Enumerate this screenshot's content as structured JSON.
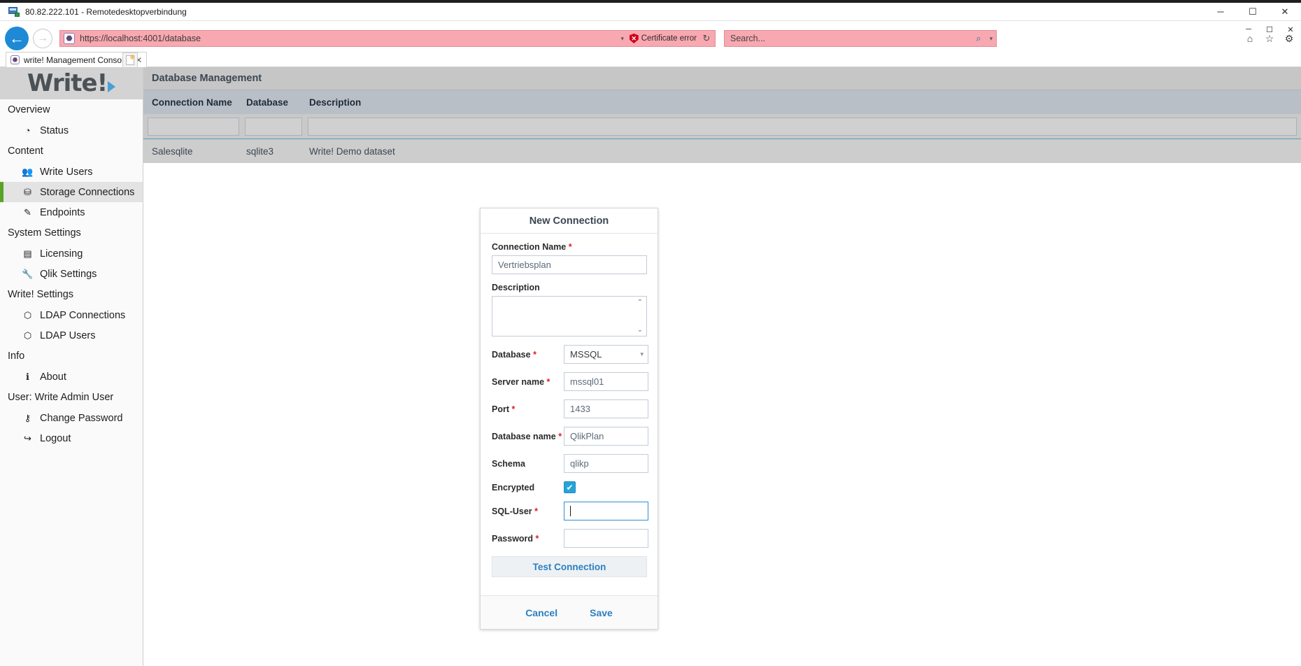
{
  "rdp": {
    "title": "80.82.222.101 - Remotedesktopverbindung",
    "icon": "remote-desktop-icon",
    "minimize": "─",
    "maximize": "☐",
    "close": "✕"
  },
  "browser": {
    "back_icon": "←",
    "forward_icon": "→",
    "favicon_glyph": "⬣",
    "url": "https://localhost:4001/database",
    "address_dropdown_icon": "▾",
    "certificate_error": "Certificate error",
    "certificate_icon": "certificate-error-shield-icon",
    "certificate_badge": "✕",
    "refresh_icon": "↻",
    "search_placeholder": "Search...",
    "search_icon": "⌕",
    "search_caret": "▾",
    "home_icon": "⌂",
    "favorites_icon": "☆",
    "tools_icon": "⚙",
    "window": {
      "minimize": "─",
      "maximize": "☐",
      "close": "✕"
    },
    "tab": {
      "label": "write! Management Console",
      "close": "✕",
      "new_tab_title": "new-tab"
    }
  },
  "logo": {
    "text": "Write",
    "mark": "!"
  },
  "sidebar": {
    "groups": [
      {
        "title": "Overview",
        "items": [
          {
            "label": "Status",
            "icon": "dashboard-icon",
            "glyph": "◔",
            "active": false
          }
        ]
      },
      {
        "title": "Content",
        "items": [
          {
            "label": "Write Users",
            "icon": "users-icon",
            "glyph": "👥",
            "active": false
          },
          {
            "label": "Storage Connections",
            "icon": "database-icon",
            "glyph": "⛁",
            "active": true
          },
          {
            "label": "Endpoints",
            "icon": "pencil-icon",
            "glyph": "✎",
            "active": false
          }
        ]
      },
      {
        "title": "System Settings",
        "items": [
          {
            "label": "Licensing",
            "icon": "id-card-icon",
            "glyph": "▤",
            "active": false
          },
          {
            "label": "Qlik Settings",
            "icon": "wrench-icon",
            "glyph": "🔧",
            "active": false
          }
        ]
      },
      {
        "title": "Write! Settings",
        "items": [
          {
            "label": "LDAP Connections",
            "icon": "ldap-connections-icon",
            "glyph": "⬡",
            "active": false
          },
          {
            "label": "LDAP Users",
            "icon": "ldap-users-icon",
            "glyph": "⬡",
            "active": false
          }
        ]
      },
      {
        "title": "Info",
        "items": [
          {
            "label": "About",
            "icon": "info-icon",
            "glyph": "ℹ",
            "active": false
          }
        ]
      },
      {
        "title": "User: Write Admin User",
        "items": [
          {
            "label": "Change Password",
            "icon": "key-icon",
            "glyph": "⚷",
            "active": false
          },
          {
            "label": "Logout",
            "icon": "logout-icon",
            "glyph": "↪",
            "active": false
          }
        ]
      }
    ]
  },
  "main": {
    "page_title": "Database Management",
    "table": {
      "columns": [
        "Connection Name",
        "Database",
        "Description"
      ],
      "filters": [
        "",
        "",
        ""
      ],
      "rows": [
        {
          "connection_name": "Salesqlite",
          "database": "sqlite3",
          "description": "Write! Demo dataset"
        }
      ]
    }
  },
  "modal": {
    "title": "New Connection",
    "fields": {
      "connection_name": {
        "label": "Connection Name",
        "required": "*",
        "value": "Vertriebsplan"
      },
      "description": {
        "label": "Description",
        "required": "",
        "value": ""
      },
      "database": {
        "label": "Database",
        "required": "*",
        "value": "MSSQL",
        "arrow": "▾"
      },
      "server_name": {
        "label": "Server name",
        "required": "*",
        "value": "mssql01"
      },
      "port": {
        "label": "Port",
        "required": "*",
        "value": "1433"
      },
      "database_name": {
        "label": "Database name",
        "required": "*",
        "value": "QlikPlan"
      },
      "schema": {
        "label": "Schema",
        "required": "",
        "value": "qlikp"
      },
      "encrypted": {
        "label": "Encrypted",
        "required": "",
        "checked_glyph": "✔"
      },
      "sql_user": {
        "label": "SQL-User",
        "required": "*",
        "value": ""
      },
      "password": {
        "label": "Password",
        "required": "*",
        "value": ""
      }
    },
    "test_connection": "Test Connection",
    "cancel": "Cancel",
    "save": "Save",
    "scroll_up_icon": "⌃",
    "scroll_down_icon": "⌄"
  },
  "colors": {
    "accent_blue": "#2b7fc2",
    "active_green": "#5aa32a",
    "required_red": "#e02020",
    "cert_error_bg": "#f8a8b0",
    "checkbox_blue": "#26a4d8"
  }
}
